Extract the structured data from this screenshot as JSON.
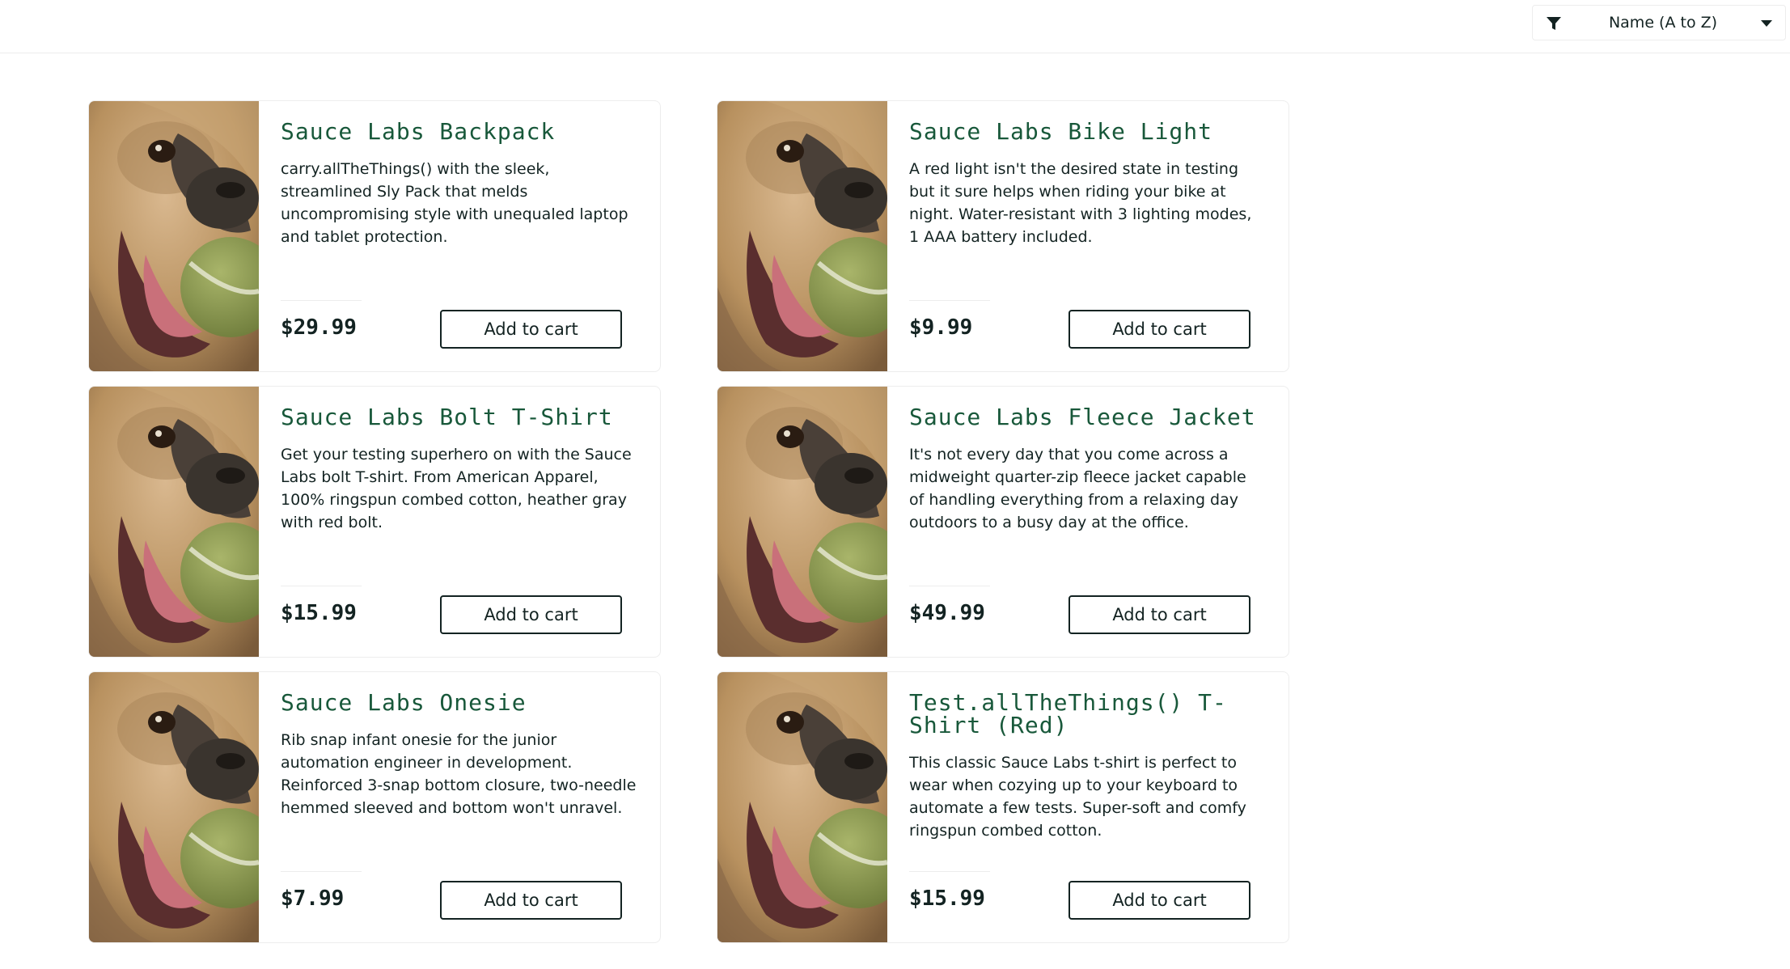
{
  "sort": {
    "selected": "Name (A to Z)",
    "filter_icon": "filter-icon",
    "chevron_icon": "chevron-down-icon"
  },
  "accent_color": "#18583a",
  "products": [
    {
      "name": "Sauce Labs Backpack",
      "description": "carry.allTheThings() with the sleek, streamlined Sly Pack that melds uncompromising style with unequaled laptop and tablet protection.",
      "price": "$29.99",
      "button": "Add to cart"
    },
    {
      "name": "Sauce Labs Bike Light",
      "description": "A red light isn't the desired state in testing but it sure helps when riding your bike at night. Water-resistant with 3 lighting modes, 1 AAA battery included.",
      "price": "$9.99",
      "button": "Add to cart"
    },
    {
      "name": "Sauce Labs Bolt T-Shirt",
      "description": "Get your testing superhero on with the Sauce Labs bolt T-shirt. From American Apparel, 100% ringspun combed cotton, heather gray with red bolt.",
      "price": "$15.99",
      "button": "Add to cart"
    },
    {
      "name": "Sauce Labs Fleece Jacket",
      "description": "It's not every day that you come across a midweight quarter-zip fleece jacket capable of handling everything from a relaxing day outdoors to a busy day at the office.",
      "price": "$49.99",
      "button": "Add to cart"
    },
    {
      "name": "Sauce Labs Onesie",
      "description": "Rib snap infant onesie for the junior automation engineer in development. Reinforced 3-snap bottom closure, two-needle hemmed sleeved and bottom won't unravel.",
      "price": "$7.99",
      "button": "Add to cart"
    },
    {
      "name": "Test.allTheThings() T-Shirt (Red)",
      "description": "This classic Sauce Labs t-shirt is perfect to wear when cozying up to your keyboard to automate a few tests. Super-soft and comfy ringspun combed cotton.",
      "price": "$15.99",
      "button": "Add to cart"
    }
  ]
}
